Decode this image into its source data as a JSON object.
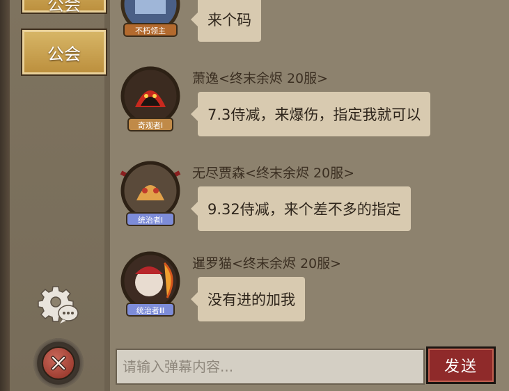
{
  "sidebar": {
    "tab_top_label": "公会",
    "tab_guild_label": "公会"
  },
  "messages": [
    {
      "name": "",
      "text": "来个码",
      "badge": "不朽领主"
    },
    {
      "name": "萧逸<终末余烬 20服>",
      "text": "7.3侍减，来爆伤，指定我就可以",
      "badge": "奇观者Ⅰ"
    },
    {
      "name": "无尽贾森<终末余烬 20服>",
      "text": "9.32侍减，来个差不多的指定",
      "badge": "统治者Ⅰ"
    },
    {
      "name": "暹罗猫<终末余烬 20服>",
      "text": "没有进的加我",
      "badge": "统治者Ⅲ"
    }
  ],
  "composer": {
    "placeholder": "请输入弹幕内容...",
    "send_label": "发送"
  },
  "icons": {
    "settings": "gear-chat-icon",
    "close": "close-icon"
  },
  "colors": {
    "background": "#8d826e",
    "bubble": "#d8cab0",
    "tab_gold": "#c9a04f",
    "send_red": "#8f2a2a"
  }
}
